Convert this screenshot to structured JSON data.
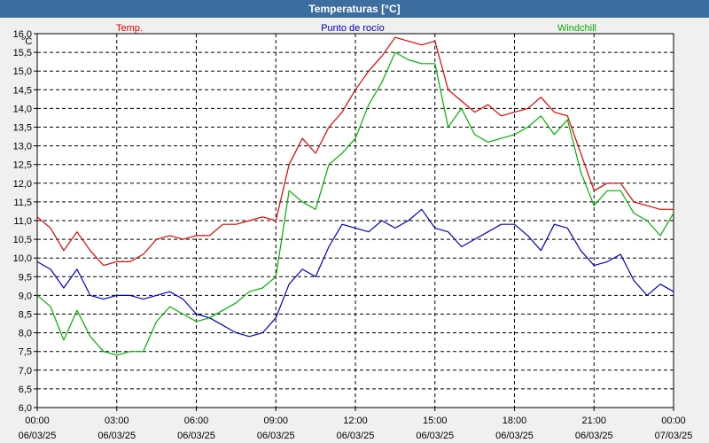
{
  "window": {
    "title": "Temperaturas [°C]"
  },
  "chart_data": {
    "type": "line",
    "title": "Temperaturas [°C]",
    "ylabel": "°C",
    "ylim": [
      6.0,
      16.0
    ],
    "xlim": [
      0,
      24
    ],
    "grid": true,
    "legend_position": "top",
    "y_ticks": [
      "6,0",
      "6,5",
      "7,0",
      "7,5",
      "8,0",
      "8,5",
      "9,0",
      "9,5",
      "10,0",
      "10,5",
      "11,0",
      "11,5",
      "12,0",
      "12,5",
      "13,0",
      "13,5",
      "14,0",
      "14,5",
      "15,0",
      "15,5",
      "16,0"
    ],
    "x_tick_hours": [
      0,
      3,
      6,
      9,
      12,
      15,
      18,
      21,
      24
    ],
    "x_ticks": [
      {
        "time": "00:00",
        "date": "06/03/25"
      },
      {
        "time": "03:00",
        "date": "06/03/25"
      },
      {
        "time": "06:00",
        "date": "06/03/25"
      },
      {
        "time": "09:00",
        "date": "06/03/25"
      },
      {
        "time": "12:00",
        "date": "06/03/25"
      },
      {
        "time": "15:00",
        "date": "06/03/25"
      },
      {
        "time": "18:00",
        "date": "06/03/25"
      },
      {
        "time": "21:00",
        "date": "06/03/25"
      },
      {
        "time": "00:00",
        "date": "07/03/25"
      }
    ],
    "x": [
      0,
      0.5,
      1,
      1.5,
      2,
      2.5,
      3,
      3.5,
      4,
      4.5,
      5,
      5.5,
      6,
      6.5,
      7,
      7.5,
      8,
      8.5,
      9,
      9.5,
      10,
      10.5,
      11,
      11.5,
      12,
      12.5,
      13,
      13.5,
      14,
      14.5,
      15,
      15.5,
      16,
      16.5,
      17,
      17.5,
      18,
      18.5,
      19,
      19.5,
      20,
      20.5,
      21,
      21.5,
      22,
      22.5,
      23,
      23.5,
      24
    ],
    "series": [
      {
        "name": "Temp.",
        "color": "#e00000",
        "values": [
          11.1,
          10.8,
          10.2,
          10.7,
          10.2,
          9.8,
          9.9,
          9.9,
          10.1,
          10.5,
          10.6,
          10.5,
          10.6,
          10.6,
          10.9,
          10.9,
          11.0,
          11.1,
          11.0,
          12.5,
          13.2,
          12.8,
          13.5,
          13.9,
          14.5,
          15.0,
          15.4,
          15.9,
          15.8,
          15.7,
          15.8,
          14.5,
          14.2,
          13.9,
          14.1,
          13.8,
          13.9,
          14.0,
          14.3,
          13.9,
          13.8,
          12.8,
          11.8,
          12.0,
          12.0,
          11.5,
          11.4,
          11.3,
          11.3
        ]
      },
      {
        "name": "Punto de rocío",
        "color": "#0000c0",
        "values": [
          9.9,
          9.7,
          9.2,
          9.7,
          9.0,
          8.9,
          9.0,
          9.0,
          8.9,
          9.0,
          9.1,
          8.9,
          8.5,
          8.4,
          8.2,
          8.0,
          7.9,
          8.0,
          8.4,
          9.3,
          9.7,
          9.5,
          10.3,
          10.9,
          10.8,
          10.7,
          11.0,
          10.8,
          11.0,
          11.3,
          10.8,
          10.7,
          10.3,
          10.5,
          10.7,
          10.9,
          10.9,
          10.6,
          10.2,
          10.9,
          10.8,
          10.2,
          9.8,
          9.9,
          10.1,
          9.4,
          9.0,
          9.3,
          9.1
        ]
      },
      {
        "name": "Windchill",
        "color": "#00b000",
        "values": [
          9.0,
          8.7,
          7.8,
          8.6,
          7.9,
          7.5,
          7.4,
          7.5,
          7.5,
          8.3,
          8.7,
          8.5,
          8.3,
          8.4,
          8.6,
          8.8,
          9.1,
          9.2,
          9.5,
          11.8,
          11.5,
          11.3,
          12.5,
          12.8,
          13.2,
          14.1,
          14.7,
          15.5,
          15.3,
          15.2,
          15.2,
          13.5,
          14.0,
          13.3,
          13.1,
          13.2,
          13.3,
          13.5,
          13.8,
          13.3,
          13.7,
          12.3,
          11.4,
          11.8,
          11.8,
          11.2,
          11.0,
          10.6,
          11.2
        ]
      }
    ]
  }
}
